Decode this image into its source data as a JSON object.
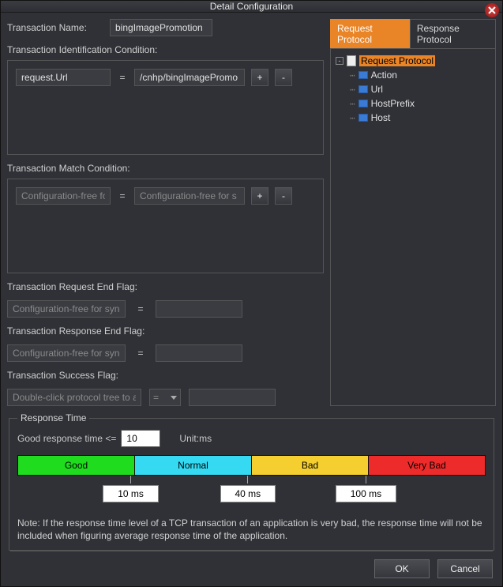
{
  "title": "Detail Configuration",
  "left": {
    "transaction_name_label": "Transaction Name:",
    "transaction_name_value": "bingImagePromotion",
    "ident_cond_label": "Transaction Identification Condition:",
    "ident_lhs": "request.Url",
    "ident_op": "=",
    "ident_rhs": "/cnhp/bingImagePromo",
    "match_cond_label": "Transaction Match Condition:",
    "match_lhs": "Configuration-free for s",
    "match_op": "=",
    "match_rhs": "Configuration-free for s",
    "req_end_label": "Transaction Request End Flag:",
    "req_end_lhs": "Configuration-free for synchr",
    "req_end_op": "=",
    "req_end_rhs": "",
    "resp_end_label": "Transaction Response End Flag:",
    "resp_end_lhs": "Configuration-free for synchr",
    "resp_end_op": "=",
    "resp_end_rhs": "",
    "succ_label": "Transaction Success Flag:",
    "succ_lhs": "Double-click protocol tree to a",
    "succ_op": "=",
    "succ_rhs": ""
  },
  "right": {
    "tabs": {
      "request": "Request Protocol",
      "response": "Response Protocol"
    },
    "tree": {
      "root": "Request Protocol",
      "children": [
        "Action",
        "Url",
        "HostPrefix",
        "Host"
      ]
    }
  },
  "response_time": {
    "legend": "Response Time",
    "good_label": "Good response time <=",
    "good_value": "10",
    "unit_label": "Unit:ms",
    "segments": {
      "good": "Good",
      "normal": "Normal",
      "bad": "Bad",
      "vbad": "Very Bad"
    },
    "marks": {
      "m1": "10 ms",
      "m2": "40 ms",
      "m3": "100 ms"
    },
    "note": "Note: If the response time level of a TCP transaction of an application is very bad, the response time will not be included when figuring average response time of the application."
  },
  "footer": {
    "ok": "OK",
    "cancel": "Cancel"
  },
  "buttons": {
    "plus": "+",
    "minus": "-"
  }
}
